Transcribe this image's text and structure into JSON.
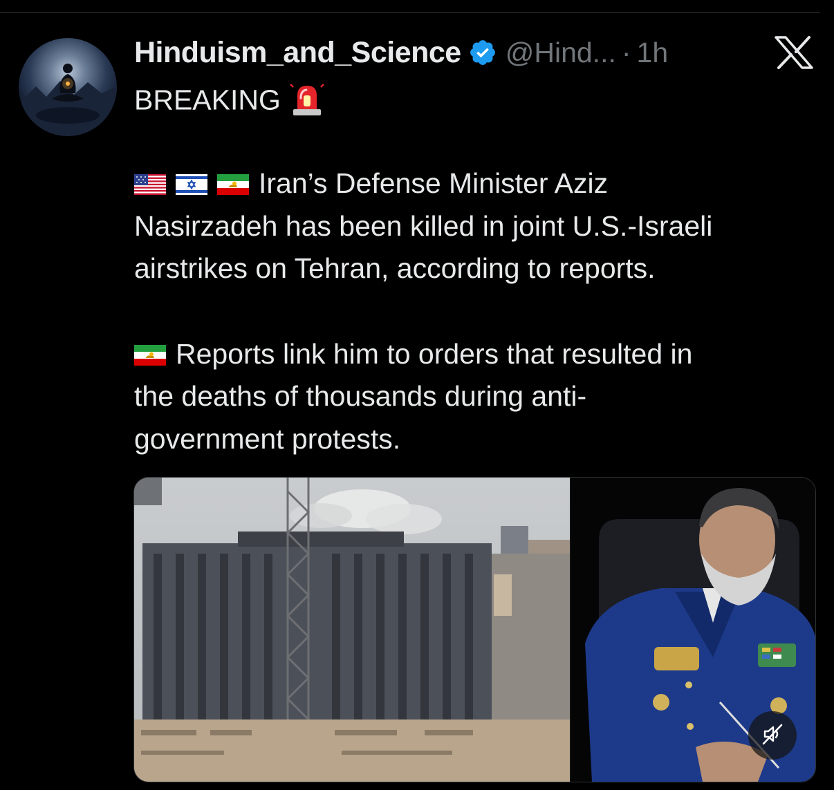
{
  "tweet": {
    "display_name": "Hinduism_and_Science",
    "handle": "@Hind...",
    "separator": "·",
    "time": "1h",
    "headline": "BREAKING",
    "paragraph1_lines": [
      "Iran’s Defense Minister Aziz",
      "Nasirzadeh has been killed in joint U.S.-Israeli",
      "airstrikes on Tehran, according to reports."
    ],
    "paragraph2_lines": [
      "Reports link him to orders that resulted in",
      "the deaths of thousands during anti-",
      "government protests."
    ]
  },
  "icons": {
    "verified": "verified-badge-icon",
    "platform": "x-logo-icon",
    "headline_emoji": "rotating-light-siren-icon",
    "flags": [
      "us-flag-icon",
      "israel-flag-icon",
      "iran-lion-sun-flag-icon"
    ],
    "media_control": "muted-speaker-icon"
  },
  "colors": {
    "background": "#000000",
    "text_primary": "#e7e9ea",
    "text_secondary": "#71767b",
    "verified_blue": "#1d9bf0"
  }
}
